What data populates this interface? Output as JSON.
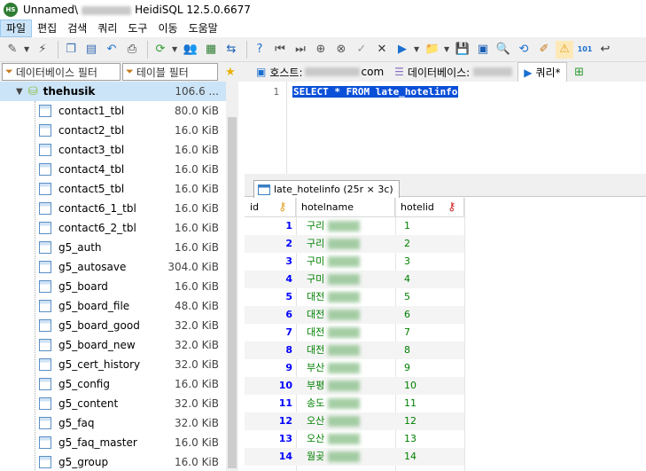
{
  "window": {
    "title_prefix": "Unnamed\\",
    "title_suffix": "HeidiSQL 12.5.0.6677"
  },
  "menu": [
    "파일",
    "편집",
    "검색",
    "쿼리",
    "도구",
    "이동",
    "도움말"
  ],
  "filters": {
    "db_filter_placeholder": "데이터베이스 필터",
    "table_filter_placeholder": "테이블 필터"
  },
  "tabs": {
    "host_label": "호스트:",
    "host_suffix": "com",
    "database_label": "데이터베이스:",
    "query_label": "쿼리*"
  },
  "tree": {
    "database": {
      "name": "thehusik",
      "size": "106.6 ..."
    },
    "tables": [
      {
        "name": "contact1_tbl",
        "size": "80.0 KiB"
      },
      {
        "name": "contact2_tbl",
        "size": "16.0 KiB"
      },
      {
        "name": "contact3_tbl",
        "size": "16.0 KiB"
      },
      {
        "name": "contact4_tbl",
        "size": "16.0 KiB"
      },
      {
        "name": "contact5_tbl",
        "size": "16.0 KiB"
      },
      {
        "name": "contact6_1_tbl",
        "size": "16.0 KiB"
      },
      {
        "name": "contact6_2_tbl",
        "size": "16.0 KiB"
      },
      {
        "name": "g5_auth",
        "size": "16.0 KiB"
      },
      {
        "name": "g5_autosave",
        "size": "304.0 KiB"
      },
      {
        "name": "g5_board",
        "size": "16.0 KiB"
      },
      {
        "name": "g5_board_file",
        "size": "48.0 KiB"
      },
      {
        "name": "g5_board_good",
        "size": "32.0 KiB"
      },
      {
        "name": "g5_board_new",
        "size": "32.0 KiB"
      },
      {
        "name": "g5_cert_history",
        "size": "32.0 KiB"
      },
      {
        "name": "g5_config",
        "size": "16.0 KiB"
      },
      {
        "name": "g5_content",
        "size": "32.0 KiB"
      },
      {
        "name": "g5_faq",
        "size": "32.0 KiB"
      },
      {
        "name": "g5_faq_master",
        "size": "16.0 KiB"
      },
      {
        "name": "g5_group",
        "size": "16.0 KiB"
      }
    ]
  },
  "editor": {
    "line_number": "1",
    "sql": "SELECT * FROM late_hotelinfo"
  },
  "result": {
    "tab_label": "late_hotelinfo (25r × 3c)",
    "columns": [
      "id",
      "hotelname",
      "hotelid"
    ],
    "rows": [
      {
        "id": "1",
        "name": "구리",
        "hotelid": "1"
      },
      {
        "id": "2",
        "name": "구리",
        "hotelid": "2"
      },
      {
        "id": "3",
        "name": "구미",
        "hotelid": "3"
      },
      {
        "id": "4",
        "name": "구미",
        "hotelid": "4"
      },
      {
        "id": "5",
        "name": "대전",
        "hotelid": "5"
      },
      {
        "id": "6",
        "name": "대전",
        "hotelid": "6"
      },
      {
        "id": "7",
        "name": "대전",
        "hotelid": "7"
      },
      {
        "id": "8",
        "name": "대전",
        "hotelid": "8"
      },
      {
        "id": "9",
        "name": "부산",
        "hotelid": "9"
      },
      {
        "id": "10",
        "name": "부평",
        "hotelid": "10"
      },
      {
        "id": "11",
        "name": "송도",
        "hotelid": "11"
      },
      {
        "id": "12",
        "name": "오산",
        "hotelid": "12"
      },
      {
        "id": "13",
        "name": "오산",
        "hotelid": "13"
      },
      {
        "id": "14",
        "name": "월곶",
        "hotelid": "14"
      }
    ]
  },
  "colors": {
    "selection": "#cce4f7",
    "sql_highlight": "#0a4fd8",
    "id_text": "#0000ff",
    "value_text": "#008000"
  }
}
